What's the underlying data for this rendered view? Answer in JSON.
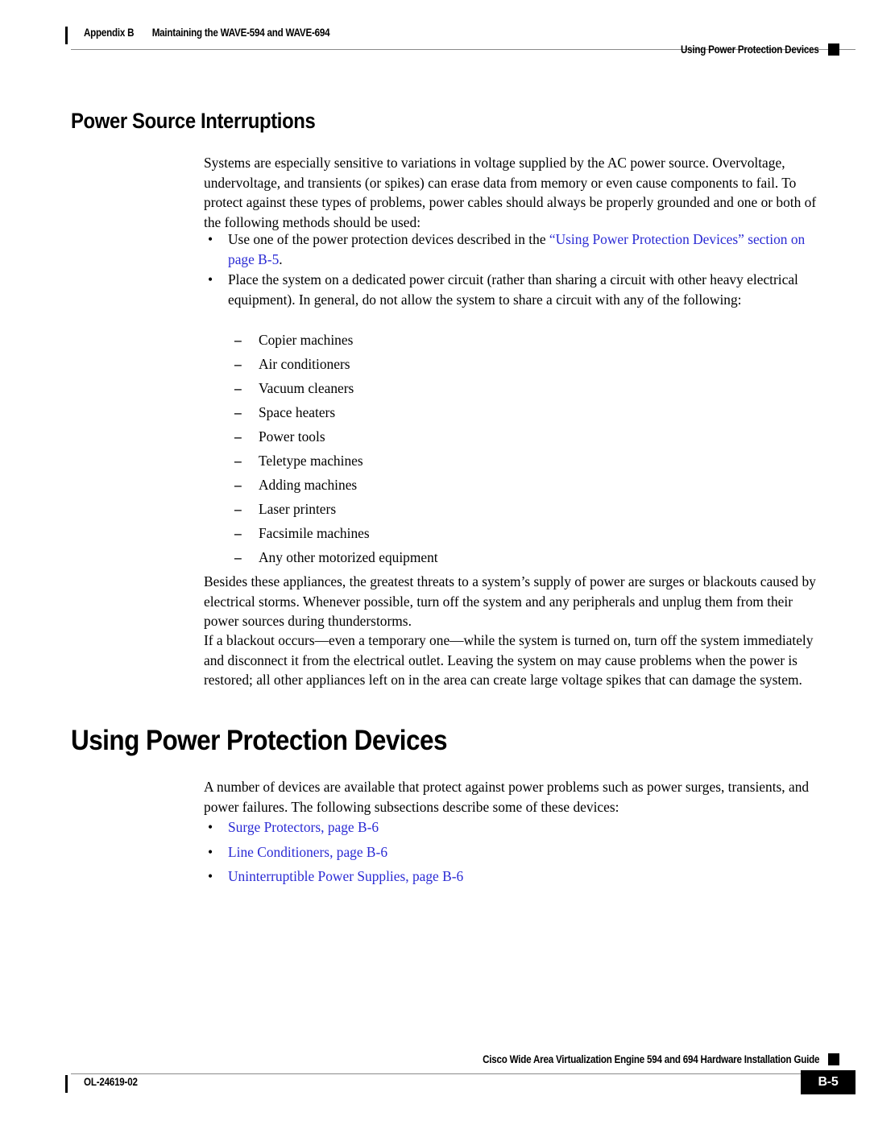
{
  "header": {
    "appendix": "Appendix B",
    "chapter_title": "Maintaining the WAVE-594 and WAVE-694",
    "right_title": "Using Power Protection Devices"
  },
  "sections": {
    "power_source_interruptions": {
      "heading": "Power Source Interruptions",
      "intro_paragraph": "Systems are especially sensitive to variations in voltage supplied by the AC power source. Overvoltage, undervoltage, and transients (or spikes) can erase data from memory or even cause components to fail. To protect against these types of problems, power cables should always be properly grounded and one or both of the following methods should be used:",
      "bullets": [
        {
          "marker": "•",
          "text_before": "Use one of the power protection devices described in the ",
          "link_text": "“Using Power Protection Devices” section",
          "text_mid": " ",
          "link_text2": "on page B-5",
          "text_after": "."
        },
        {
          "marker": "•",
          "text_before": "Place the system on a dedicated power circuit (rather than sharing a circuit with other heavy electrical equipment). In general, do not allow the system to share a circuit with any of the following:",
          "link_text": "",
          "text_mid": "",
          "link_text2": "",
          "text_after": ""
        }
      ],
      "dash_marker": "–",
      "dash_items": [
        "Copier machines",
        "Air conditioners",
        "Vacuum cleaners",
        "Space heaters",
        "Power tools",
        "Teletype machines",
        "Adding machines",
        "Laser printers",
        "Facsimile machines",
        "Any other motorized equipment"
      ],
      "paragraph_surges": "Besides these appliances, the greatest threats to a system’s supply of power are surges or blackouts caused by electrical storms. Whenever possible, turn off the system and any peripherals and unplug them from their power sources during thunderstorms.",
      "paragraph_blackout": "If a blackout occurs—even a temporary one—while the system is turned on, turn off the system immediately and disconnect it from the electrical outlet. Leaving the system on may cause problems when the power is restored; all other appliances left on in the area can create large voltage spikes that can damage the system."
    },
    "using_power_protection_devices": {
      "heading": "Using Power Protection Devices",
      "intro_paragraph": "A number of devices are available that protect against power problems such as power surges, transients, and power failures. The following subsections describe some of these devices:",
      "bullet_marker": "•",
      "links": [
        "Surge Protectors, page B-6",
        "Line Conditioners, page B-6",
        "Uninterruptible Power Supplies, page B-6"
      ]
    }
  },
  "footer": {
    "guide_title": "Cisco Wide Area Virtualization Engine 594 and 694 Hardware Installation Guide",
    "doc_id": "OL-24619-02",
    "page_number": "B-5"
  },
  "colors": {
    "link": "#2b2bd4",
    "rule": "#8a8a8a",
    "text": "#000000",
    "page_box_bg": "#000000",
    "page_box_fg": "#ffffff"
  }
}
